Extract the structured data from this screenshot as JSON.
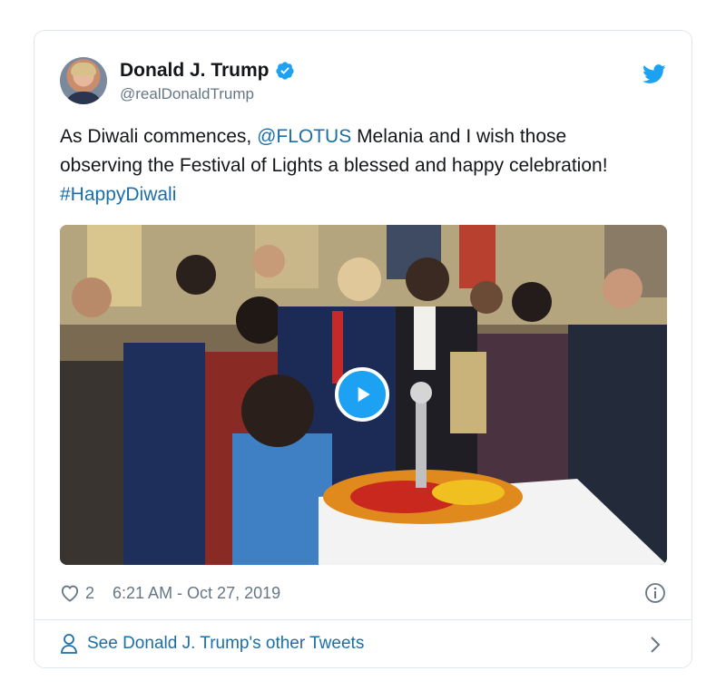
{
  "tweet": {
    "author": {
      "name": "Donald J. Trump",
      "handle": "@realDonaldTrump",
      "verified": true
    },
    "text": {
      "part1": "As Diwali commences, ",
      "mention": "@FLOTUS",
      "part2": " Melania and I wish those observing the Festival of Lights a blessed and happy celebration! ",
      "hashtag": "#HappyDiwali"
    },
    "media": {
      "type": "video",
      "play_icon": "play-icon"
    },
    "likes": "2",
    "timestamp": "6:21 AM - Oct 27, 2019"
  },
  "footer": {
    "see_more_label": "See Donald J. Trump's other Tweets"
  },
  "colors": {
    "link": "#1b6fa8",
    "twitter_blue": "#1da1f2",
    "muted_text": "#657786",
    "border": "#e1e8ed"
  },
  "icons": {
    "brand": "twitter-bird-icon",
    "verified": "verified-badge-icon",
    "like": "heart-icon",
    "info": "info-icon",
    "profile": "person-icon",
    "chevron": "chevron-right-icon"
  }
}
